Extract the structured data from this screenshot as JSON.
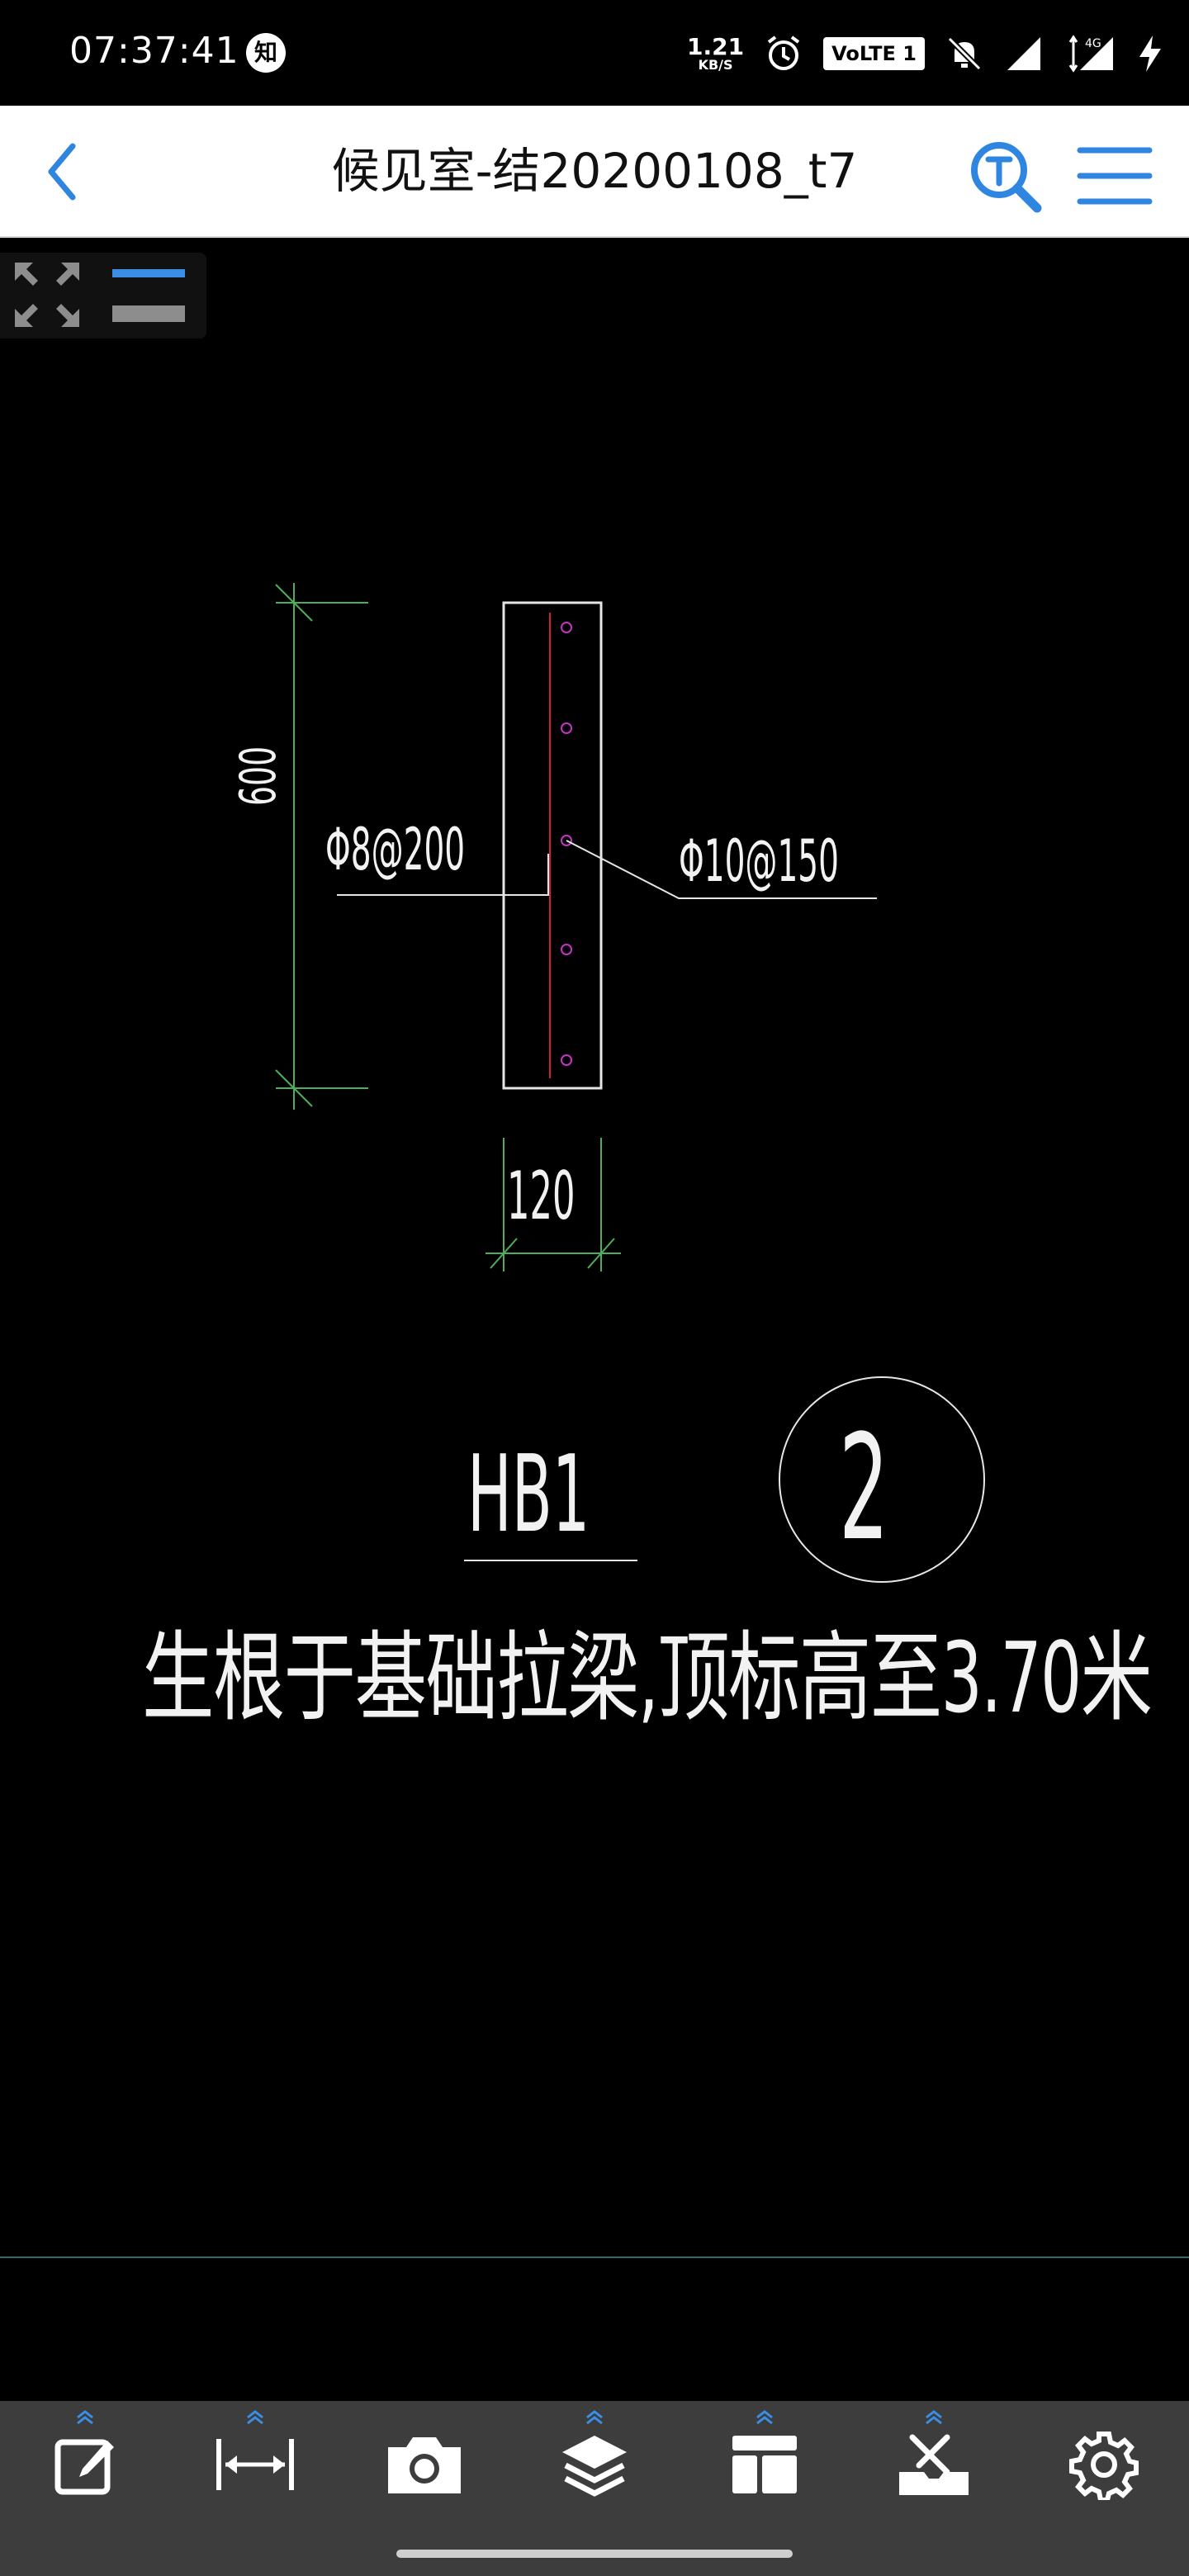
{
  "status_bar": {
    "time": "07:37:41",
    "app_badge": "知",
    "net_speed_value": "1.21",
    "net_speed_unit": "KB/S",
    "volte_label": "VoLTE 1",
    "net_type": "4G"
  },
  "header": {
    "title": "候见室-结20200108_t7"
  },
  "drawing": {
    "dim_height": "600",
    "dim_width": "120",
    "rebar_left_label": "Φ8@200",
    "rebar_right_label": "Φ10@150",
    "member_name": "HB1",
    "detail_number": "2",
    "note": "生根于基础拉梁,顶标高至3.70米",
    "colors": {
      "outline": "#e6e6e6",
      "dimension": "#4fae5a",
      "rebar_line": "#d0213a",
      "rebar_dot": "#c535c5"
    }
  },
  "toolbar": {
    "items": [
      {
        "name": "edit-tool",
        "icon": "edit-icon",
        "has_menu": true
      },
      {
        "name": "measure-tool",
        "icon": "measure-icon",
        "has_menu": true
      },
      {
        "name": "camera-tool",
        "icon": "camera-icon",
        "has_menu": false
      },
      {
        "name": "layers-tool",
        "icon": "layers-icon",
        "has_menu": true
      },
      {
        "name": "layout-tool",
        "icon": "layout-icon",
        "has_menu": true
      },
      {
        "name": "tools-box",
        "icon": "toolbox-icon",
        "has_menu": true
      },
      {
        "name": "settings",
        "icon": "gear-icon",
        "has_menu": false
      }
    ],
    "accent_color": "#3a8ee6"
  }
}
